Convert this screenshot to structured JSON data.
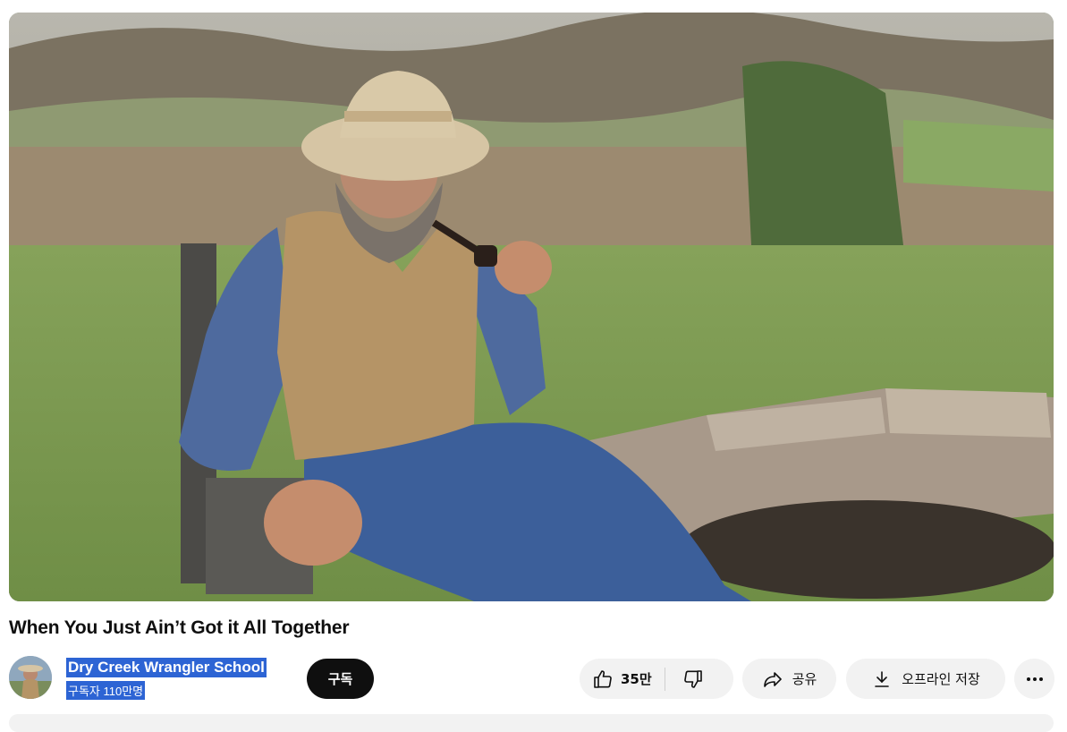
{
  "video": {
    "title": "When You Just Ain’t Got it All Together"
  },
  "channel": {
    "name": "Dry Creek Wrangler School",
    "subscribers": "구독자 110만명"
  },
  "actions": {
    "subscribe_label": "구독",
    "like_count": "35만",
    "share_label": "공유",
    "download_label": "오프라인 저장"
  },
  "icons": {
    "like": "thumbs-up-icon",
    "dislike": "thumbs-down-icon",
    "share": "share-arrow-icon",
    "download": "download-icon",
    "more": "more-horizontal-icon"
  },
  "colors": {
    "selection_highlight": "#2d64d4",
    "subscribe_bg": "#0f0f0f",
    "pill_bg": "#f2f2f2"
  }
}
